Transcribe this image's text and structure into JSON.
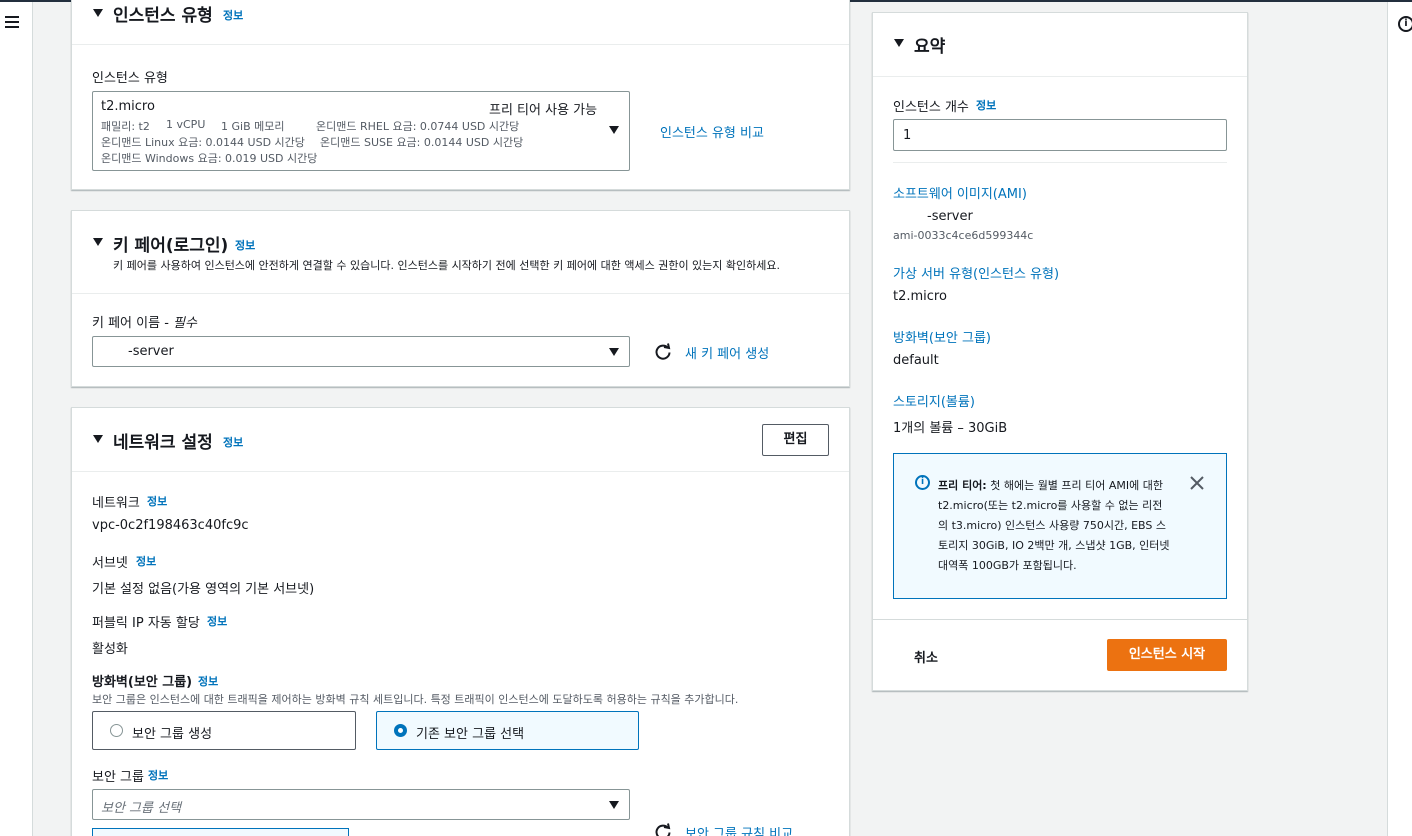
{
  "instance_type_section": {
    "title": "인스턴스 유형",
    "info": "정보",
    "field_label": "인스턴스 유형",
    "selected": "t2.micro",
    "free_tier": "프리 티어 사용 가능",
    "detail_family": "패밀리: t2",
    "detail_vcpu": "1 vCPU",
    "detail_memory": "1 GiB 메모리",
    "detail_rhel": "온디맨드 RHEL 요금: 0.0744 USD 시간당",
    "detail_linux": "온디맨드 Linux 요금: 0.0144 USD 시간당",
    "detail_suse": "온디맨드 SUSE 요금: 0.0144 USD 시간당",
    "detail_windows": "온디맨드 Windows 요금: 0.019 USD 시간당",
    "compare_link": "인스턴스 유형 비교"
  },
  "key_pair_section": {
    "title": "키 페어(로그인)",
    "info": "정보",
    "description": "키 페어를 사용하여 인스턴스에 안전하게 연결할 수 있습니다. 인스턴스를 시작하기 전에 선택한 키 페어에 대한 액세스 권한이 있는지 확인하세요.",
    "field_label": "키 페어 이름 - ",
    "required": "필수",
    "selected": "-server",
    "create_link": "새 키 페어 생성"
  },
  "network_section": {
    "title": "네트워크 설정",
    "info": "정보",
    "edit_button": "편집",
    "network_label": "네트워크",
    "network_value": "vpc-0c2f198463c40fc9c",
    "subnet_label": "서브넷",
    "subnet_value": "기본 설정 없음(가용 영역의 기본 서브넷)",
    "public_ip_label": "퍼블릭 IP 자동 할당",
    "public_ip_value": "활성화",
    "firewall_label": "방화벽(보안 그룹)",
    "firewall_description": "보안 그룹은 인스턴스에 대한 트래픽을 제어하는 방화벽 규칙 세트입니다. 특정 트래픽이 인스턴스에 도달하도록 허용하는 규칙을 추가합니다.",
    "radio_create": "보안 그룹 생성",
    "radio_existing": "기존 보안 그룹 선택",
    "sg_label": "보안 그룹",
    "sg_placeholder": "보안 그룹 선택",
    "sg_compare_link": "보안 그룹 규칙 비교"
  },
  "summary": {
    "title": "요약",
    "count_label": "인스턴스 개수",
    "info": "정보",
    "count_value": "1",
    "ami_label": "소프트웨어 이미지(AMI)",
    "ami_name": "-server",
    "ami_id": "ami-0033c4ce6d599344c",
    "server_type_label": "가상 서버 유형(인스턴스 유형)",
    "server_type_value": "t2.micro",
    "firewall_label": "방화벽(보안 그룹)",
    "firewall_value": "default",
    "storage_label": "스토리지(볼륨)",
    "storage_value": "1개의 볼륨 – 30GiB",
    "alert_title": "프리 티어:",
    "alert_line1": "첫 해에는 월별 프리 티어 AMI에 대한",
    "alert_line2": "t2.micro(또는 t2.micro를 사용할 수 없는 리전",
    "alert_line3": "의 t3.micro) 인스턴스 사용량 750시간, EBS 스",
    "alert_line4": "토리지 30GiB, IO 2백만 개, 스냅샷 1GB, 인터넷",
    "alert_line5": "대역폭 100GB가 포함됩니다.",
    "cancel": "취소",
    "launch": "인스턴스 시작"
  },
  "colors": {
    "link": "#0073bb",
    "primary": "#ec7211",
    "border": "#d5dbdb"
  }
}
